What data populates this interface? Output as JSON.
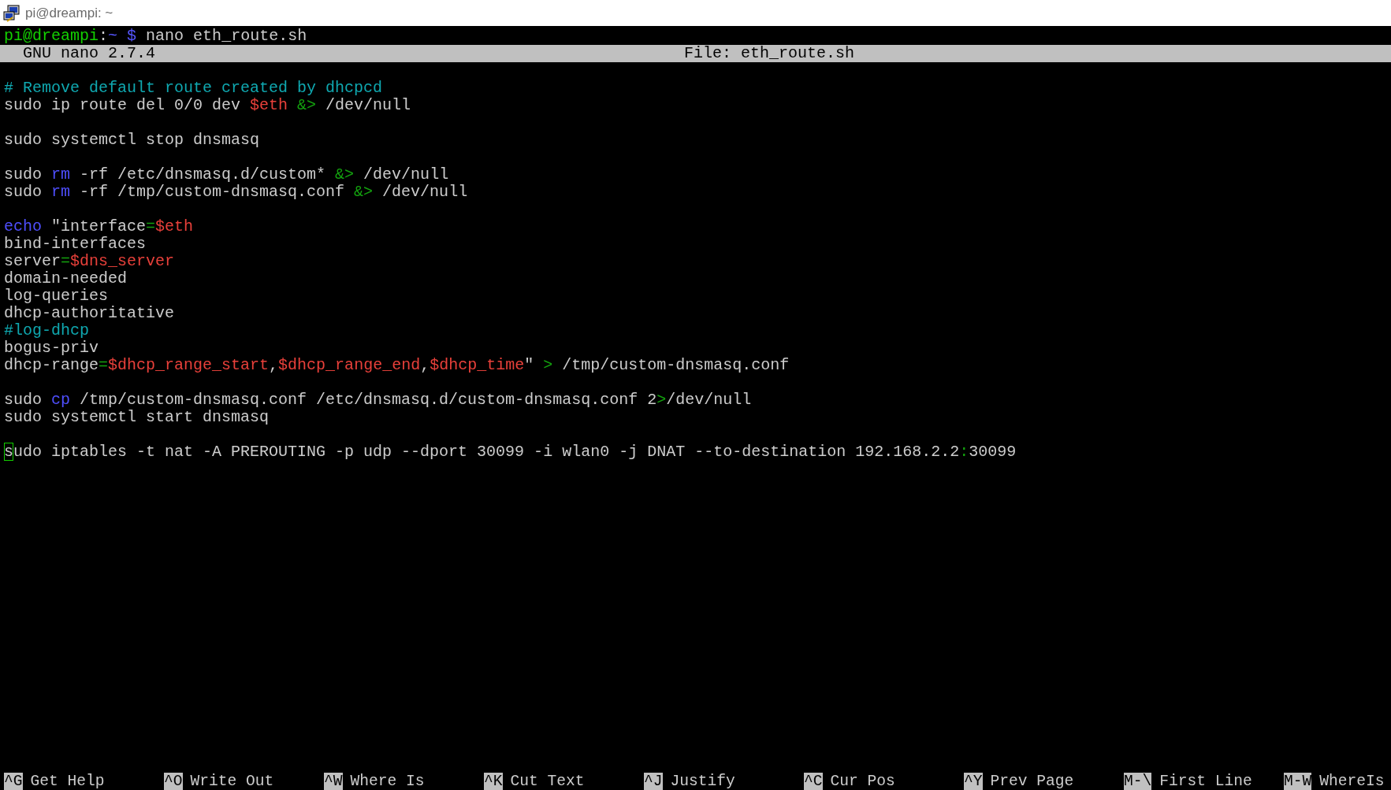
{
  "window": {
    "title": "pi@dreampi: ~"
  },
  "prompt": {
    "user_host": "pi@dreampi",
    "colon": ":",
    "path": "~",
    "symbol": "$",
    "command": "nano eth_route.sh"
  },
  "header": {
    "version": "GNU nano 2.7.4",
    "file": "File: eth_route.sh"
  },
  "lines": [
    {
      "kind": "blank"
    },
    {
      "kind": "code",
      "segments": [
        {
          "text": "# Remove default route created by dhcpcd",
          "kind": "comment"
        }
      ]
    },
    {
      "kind": "code",
      "segments": [
        {
          "text": "sudo ip route del 0/0 dev ",
          "kind": "plain"
        },
        {
          "text": "$eth",
          "kind": "variable"
        },
        {
          "text": " &>",
          "kind": "operator"
        },
        {
          "text": " /dev/null",
          "kind": "plain"
        }
      ]
    },
    {
      "kind": "blank"
    },
    {
      "kind": "code",
      "segments": [
        {
          "text": "sudo systemctl stop dnsmasq",
          "kind": "plain"
        }
      ]
    },
    {
      "kind": "blank"
    },
    {
      "kind": "code",
      "segments": [
        {
          "text": "sudo ",
          "kind": "plain"
        },
        {
          "text": "rm",
          "kind": "keyword"
        },
        {
          "text": " -rf /etc/dnsmasq.d/custom* ",
          "kind": "plain"
        },
        {
          "text": "&>",
          "kind": "operator"
        },
        {
          "text": " /dev/null",
          "kind": "plain"
        }
      ]
    },
    {
      "kind": "code",
      "segments": [
        {
          "text": "sudo ",
          "kind": "plain"
        },
        {
          "text": "rm",
          "kind": "keyword"
        },
        {
          "text": " -rf /tmp/custom-dnsmasq.conf ",
          "kind": "plain"
        },
        {
          "text": "&>",
          "kind": "operator"
        },
        {
          "text": " /dev/null",
          "kind": "plain"
        }
      ]
    },
    {
      "kind": "blank"
    },
    {
      "kind": "code",
      "segments": [
        {
          "text": "echo",
          "kind": "keyword"
        },
        {
          "text": " \"interface",
          "kind": "plain"
        },
        {
          "text": "=",
          "kind": "operator"
        },
        {
          "text": "$eth",
          "kind": "variable"
        }
      ]
    },
    {
      "kind": "code",
      "segments": [
        {
          "text": "bind-interfaces",
          "kind": "plain"
        }
      ]
    },
    {
      "kind": "code",
      "segments": [
        {
          "text": "server",
          "kind": "plain"
        },
        {
          "text": "=",
          "kind": "operator"
        },
        {
          "text": "$dns_server",
          "kind": "variable"
        }
      ]
    },
    {
      "kind": "code",
      "segments": [
        {
          "text": "domain-needed",
          "kind": "plain"
        }
      ]
    },
    {
      "kind": "code",
      "segments": [
        {
          "text": "log-queries",
          "kind": "plain"
        }
      ]
    },
    {
      "kind": "code",
      "segments": [
        {
          "text": "dhcp-authoritative",
          "kind": "plain"
        }
      ]
    },
    {
      "kind": "code",
      "segments": [
        {
          "text": "#log-dhcp",
          "kind": "comment"
        }
      ]
    },
    {
      "kind": "code",
      "segments": [
        {
          "text": "bogus-priv",
          "kind": "plain"
        }
      ]
    },
    {
      "kind": "code",
      "segments": [
        {
          "text": "dhcp-range",
          "kind": "plain"
        },
        {
          "text": "=",
          "kind": "operator"
        },
        {
          "text": "$dhcp_range_start",
          "kind": "variable"
        },
        {
          "text": ",",
          "kind": "plain"
        },
        {
          "text": "$dhcp_range_end",
          "kind": "variable"
        },
        {
          "text": ",",
          "kind": "plain"
        },
        {
          "text": "$dhcp_time",
          "kind": "variable"
        },
        {
          "text": "\" ",
          "kind": "plain"
        },
        {
          "text": ">",
          "kind": "operator"
        },
        {
          "text": " /tmp/custom-dnsmasq.conf",
          "kind": "plain"
        }
      ]
    },
    {
      "kind": "blank"
    },
    {
      "kind": "code",
      "segments": [
        {
          "text": "sudo ",
          "kind": "plain"
        },
        {
          "text": "cp",
          "kind": "keyword"
        },
        {
          "text": " /tmp/custom-dnsmasq.conf /etc/dnsmasq.d/custom-dnsmasq.conf 2",
          "kind": "plain"
        },
        {
          "text": ">",
          "kind": "operator"
        },
        {
          "text": "/dev/null",
          "kind": "plain"
        }
      ]
    },
    {
      "kind": "code",
      "segments": [
        {
          "text": "sudo systemctl start dnsmasq",
          "kind": "plain"
        }
      ]
    },
    {
      "kind": "blank"
    },
    {
      "kind": "code",
      "segments": [
        {
          "text": "s",
          "kind": "cursor"
        },
        {
          "text": "udo iptables -t nat -A PREROUTING -p udp --dport 30099 -i wlan0 -j DNAT --to-destination 192.168.2.2",
          "kind": "plain"
        },
        {
          "text": ":",
          "kind": "operator"
        },
        {
          "text": "30099",
          "kind": "plain"
        }
      ]
    }
  ],
  "shortcuts": [
    {
      "key": "^G",
      "label": "Get Help"
    },
    {
      "key": "^O",
      "label": "Write Out"
    },
    {
      "key": "^W",
      "label": "Where Is"
    },
    {
      "key": "^K",
      "label": "Cut Text"
    },
    {
      "key": "^J",
      "label": "Justify"
    },
    {
      "key": "^C",
      "label": "Cur Pos"
    },
    {
      "key": "^Y",
      "label": "Prev Page"
    },
    {
      "key": "M-\\",
      "label": "First Line"
    },
    {
      "key": "M-W",
      "label": "WhereIs"
    }
  ]
}
